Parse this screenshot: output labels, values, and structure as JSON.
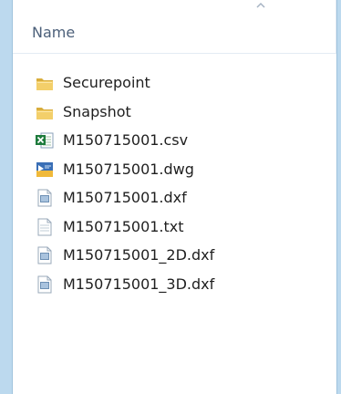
{
  "column_header": {
    "name_label": "Name"
  },
  "files": [
    {
      "name": "Securepoint",
      "icon": "folder-icon"
    },
    {
      "name": "Snapshot",
      "icon": "folder-icon"
    },
    {
      "name": "M150715001.csv",
      "icon": "excel-csv-icon"
    },
    {
      "name": "M150715001.dwg",
      "icon": "dwg-icon"
    },
    {
      "name": "M150715001.dxf",
      "icon": "dxf-file-icon"
    },
    {
      "name": "M150715001.txt",
      "icon": "text-file-icon"
    },
    {
      "name": "M150715001_2D.dxf",
      "icon": "dxf-file-icon"
    },
    {
      "name": "M150715001_3D.dxf",
      "icon": "dxf-file-icon"
    }
  ],
  "colors": {
    "frame": "#bcd9ee",
    "header_text": "#4c607a",
    "folder": "#e9c35d"
  }
}
